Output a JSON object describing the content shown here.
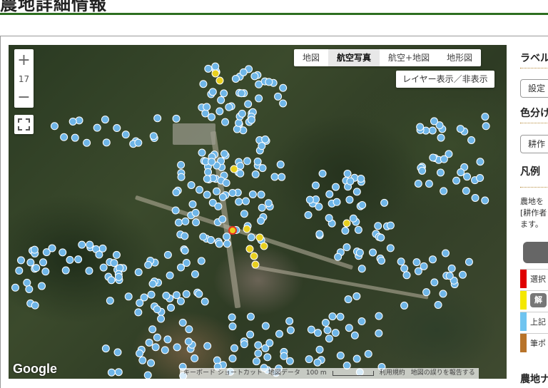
{
  "page": {
    "title": "農地詳細情報"
  },
  "map": {
    "zoom_level": "17",
    "zoom_in_label": "+",
    "zoom_out_label": "−",
    "map_types": [
      {
        "label": "地図",
        "active": false
      },
      {
        "label": "航空写真",
        "active": true
      },
      {
        "label": "航空+地図",
        "active": false
      },
      {
        "label": "地形図",
        "active": false
      }
    ],
    "layer_toggle_label": "レイヤー表示／非表示",
    "google_logo": "Google",
    "attribution": {
      "shortcuts": "キーボード ショートカット",
      "map_data": "地図データ",
      "scale": "100 m",
      "terms": "利用規約",
      "report": "地図の誤りを報告する"
    },
    "marker_colors": {
      "default": "#6fb6e8",
      "highlight": "#e8d020",
      "selected": "#e83020"
    }
  },
  "sidebar": {
    "label_heading": "ラベル",
    "settings_button": "設定",
    "color_heading": "色分け",
    "color_button": "耕作",
    "legend_heading": "凡例",
    "description": [
      "農地を",
      "[耕作者",
      "ます。"
    ],
    "legend_items": [
      {
        "color": "#e00000",
        "text": "選択"
      },
      {
        "color": "#f4e800",
        "text": "解"
      },
      {
        "color": "#6fc4f0",
        "text": "上記"
      },
      {
        "color": "#b8742a",
        "text": "筆ポ"
      }
    ],
    "footer_heading": "農地ナ"
  }
}
